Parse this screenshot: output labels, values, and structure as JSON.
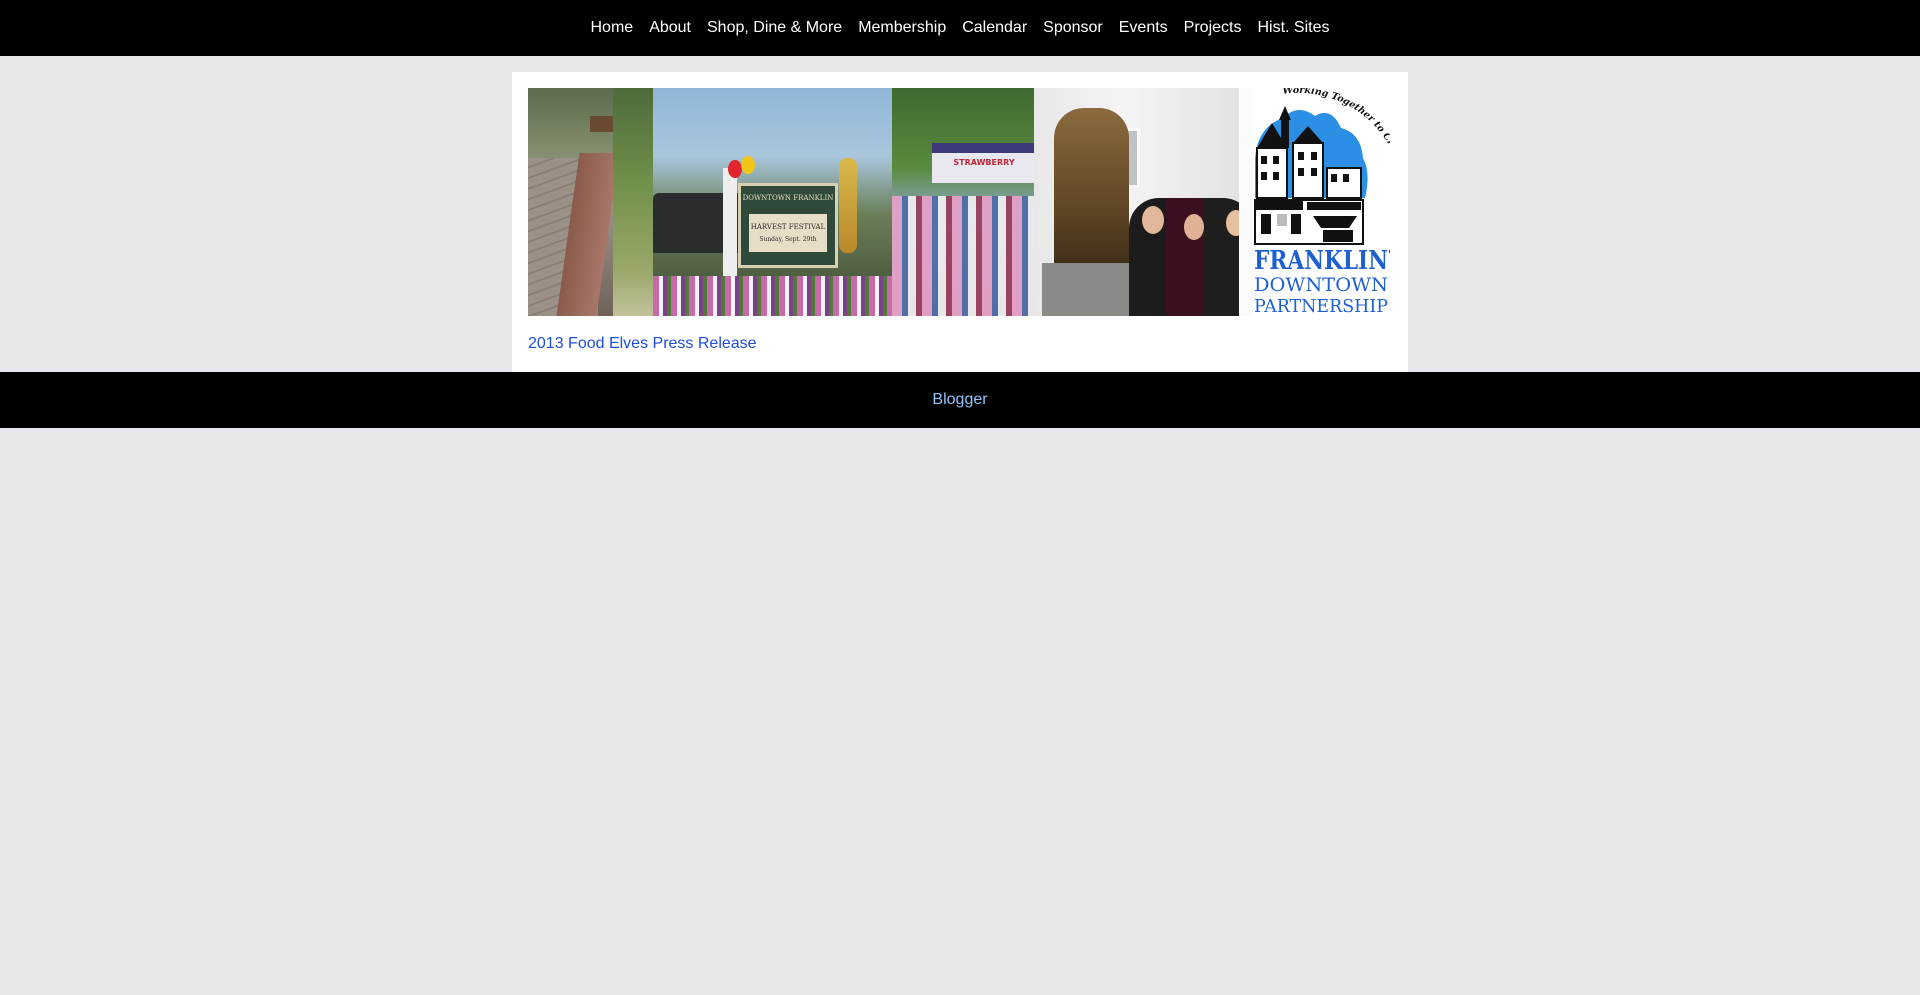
{
  "nav": {
    "items": [
      {
        "label": "Home"
      },
      {
        "label": "About"
      },
      {
        "label": "Shop, Dine & More"
      },
      {
        "label": "Membership"
      },
      {
        "label": "Calendar"
      },
      {
        "label": "Sponsor"
      },
      {
        "label": "Events"
      },
      {
        "label": "Projects"
      },
      {
        "label": "Hist. Sites"
      }
    ]
  },
  "banner": {
    "photo_texts": {
      "sign_name": "DOWNTOWN FRANKLIN",
      "sign_event": "HARVEST FESTIVAL",
      "sign_date": "Sunday, Sept. 29th",
      "tent_text": "STRAWBERRY"
    },
    "logo": {
      "arc_text": "Working Together to Create a Vital Downtown",
      "line1": "FRANKLIN",
      "line2": "DOWNTOWN",
      "line3": "PARTNERSHIP"
    }
  },
  "main": {
    "link_label": "2013 Food Elves Press Release"
  },
  "footer": {
    "link_label": "Blogger"
  },
  "colors": {
    "nav_bg": "#000000",
    "page_bg": "#e5e7eb",
    "link": "#1d4ed8",
    "footer_link": "#93c5fd",
    "logo_blue": "#2b8fe6",
    "logo_text_blue": "#1e5fd1"
  }
}
